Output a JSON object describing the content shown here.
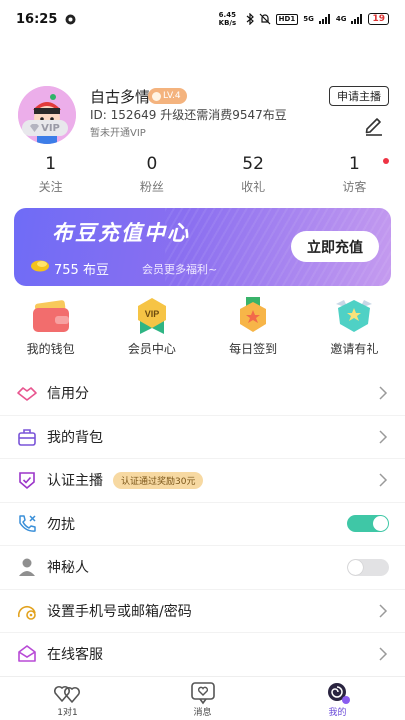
{
  "status_bar": {
    "time": "16:25",
    "speed": "6.45 KB/s",
    "hd": "HD1",
    "network1": "5G",
    "network2": "4G",
    "battery": "19"
  },
  "profile": {
    "name": "自古多情",
    "level": "LV.4",
    "id_line": "ID: 152649 升级还需消费9547布豆",
    "vip_status": "暂未开通VIP",
    "vip_badge": "VIP",
    "apply_button": "申请主播"
  },
  "stats": [
    {
      "value": "1",
      "label": "关注"
    },
    {
      "value": "0",
      "label": "粉丝"
    },
    {
      "value": "52",
      "label": "收礼"
    },
    {
      "value": "1",
      "label": "访客"
    }
  ],
  "banner": {
    "title": "布豆充值中心",
    "balance": "755 布豆",
    "subtitle": "会员更多福利~",
    "button": "立即充值"
  },
  "quick_actions": [
    {
      "label": "我的钱包",
      "icon": "wallet-icon"
    },
    {
      "label": "会员中心",
      "icon": "vip-badge-icon"
    },
    {
      "label": "每日签到",
      "icon": "daily-checkin-icon"
    },
    {
      "label": "邀请有礼",
      "icon": "invite-gift-icon"
    }
  ],
  "menu": [
    {
      "label": "信用分",
      "icon": "handshake-icon"
    },
    {
      "label": "我的背包",
      "icon": "backpack-icon"
    },
    {
      "label": "认证主播",
      "icon": "verified-shield-icon",
      "tag": "认证通过奖励30元"
    },
    {
      "label": "勿扰",
      "icon": "phone-mute-icon",
      "toggle": true
    },
    {
      "label": "神秘人",
      "icon": "person-icon",
      "toggle": false
    },
    {
      "label": "设置手机号或邮箱/密码",
      "icon": "settings-icon"
    },
    {
      "label": "在线客服",
      "icon": "mail-icon"
    }
  ],
  "tabbar": [
    {
      "label": "1对1",
      "icon": "hearts-icon",
      "active": false
    },
    {
      "label": "消息",
      "icon": "message-icon",
      "active": false
    },
    {
      "label": "我的",
      "icon": "profile-icon",
      "active": true
    }
  ],
  "colors": {
    "accent": "#6a4ad8",
    "banner_start": "#6f6cf6",
    "banner_end": "#c59bef",
    "toggle_on": "#3fc7a6",
    "level_badge": "#f4b37e",
    "notification_dot": "#ee3344"
  }
}
